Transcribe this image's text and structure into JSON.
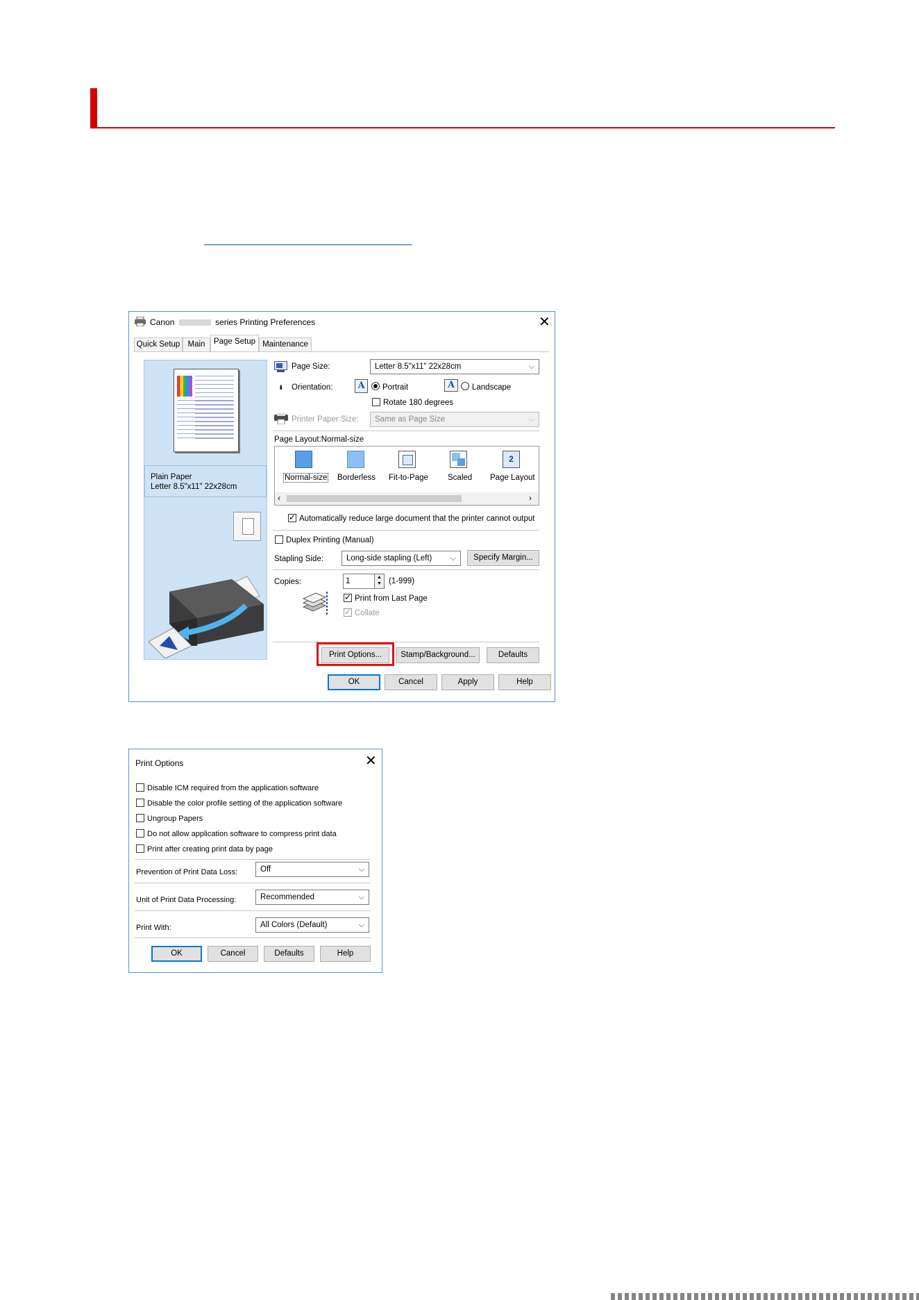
{
  "dialog1": {
    "title": "Canon",
    "title_suffix": "series Printing Preferences",
    "tabs": [
      "Quick Setup",
      "Main",
      "Page Setup",
      "Maintenance"
    ],
    "preview": {
      "media_line1": "Plain Paper",
      "media_line2": "Letter 8.5\"x11\" 22x28cm"
    },
    "page_size_label": "Page Size:",
    "page_size_value": "Letter 8.5\"x11\" 22x28cm",
    "orientation_label": "Orientation:",
    "portrait_label": "Portrait",
    "landscape_label": "Landscape",
    "rotate_label": "Rotate 180 degrees",
    "printer_paper_size_label": "Printer Paper Size:",
    "printer_paper_size_value": "Same as Page Size",
    "page_layout_label": "Page Layout:Normal-size",
    "layouts": [
      {
        "label": "Normal-size",
        "icon": "normal-size-icon"
      },
      {
        "label": "Borderless",
        "icon": "borderless-icon"
      },
      {
        "label": "Fit-to-Page",
        "icon": "fit-to-page-icon"
      },
      {
        "label": "Scaled",
        "icon": "scaled-icon"
      },
      {
        "label": "Page Layout",
        "icon": "page-layout-icon",
        "badge": "2"
      }
    ],
    "auto_reduce_label": "Automatically reduce large document that the printer cannot output",
    "duplex_label": "Duplex Printing (Manual)",
    "stapling_side_label": "Stapling Side:",
    "stapling_side_value": "Long-side stapling (Left)",
    "specify_margin_label": "Specify Margin...",
    "copies_label": "Copies:",
    "copies_value": "1",
    "copies_range": "(1-999)",
    "print_from_last_label": "Print from Last Page",
    "collate_label": "Collate",
    "print_options_label": "Print Options...",
    "stamp_background_label": "Stamp/Background...",
    "defaults_label": "Defaults",
    "ok_label": "OK",
    "cancel_label": "Cancel",
    "apply_label": "Apply",
    "help_label": "Help",
    "highlight_color": "#e01010"
  },
  "dialog2": {
    "title": "Print Options",
    "options": [
      {
        "label": "Disable ICM required from the application software",
        "checked": false
      },
      {
        "label": "Disable the color profile setting of the application software",
        "checked": false
      },
      {
        "label": "Ungroup Papers",
        "checked": false
      },
      {
        "label": "Do not allow application software to compress print data",
        "checked": false
      },
      {
        "label": "Print after creating print data by page",
        "checked": false
      }
    ],
    "prevention_label": "Prevention of Print Data Loss:",
    "prevention_value": "Off",
    "unit_label": "Unit of Print Data Processing:",
    "unit_value": "Recommended",
    "print_with_label": "Print With:",
    "print_with_value": "All Colors (Default)",
    "ok_label": "OK",
    "cancel_label": "Cancel",
    "defaults_label": "Defaults",
    "help_label": "Help"
  }
}
